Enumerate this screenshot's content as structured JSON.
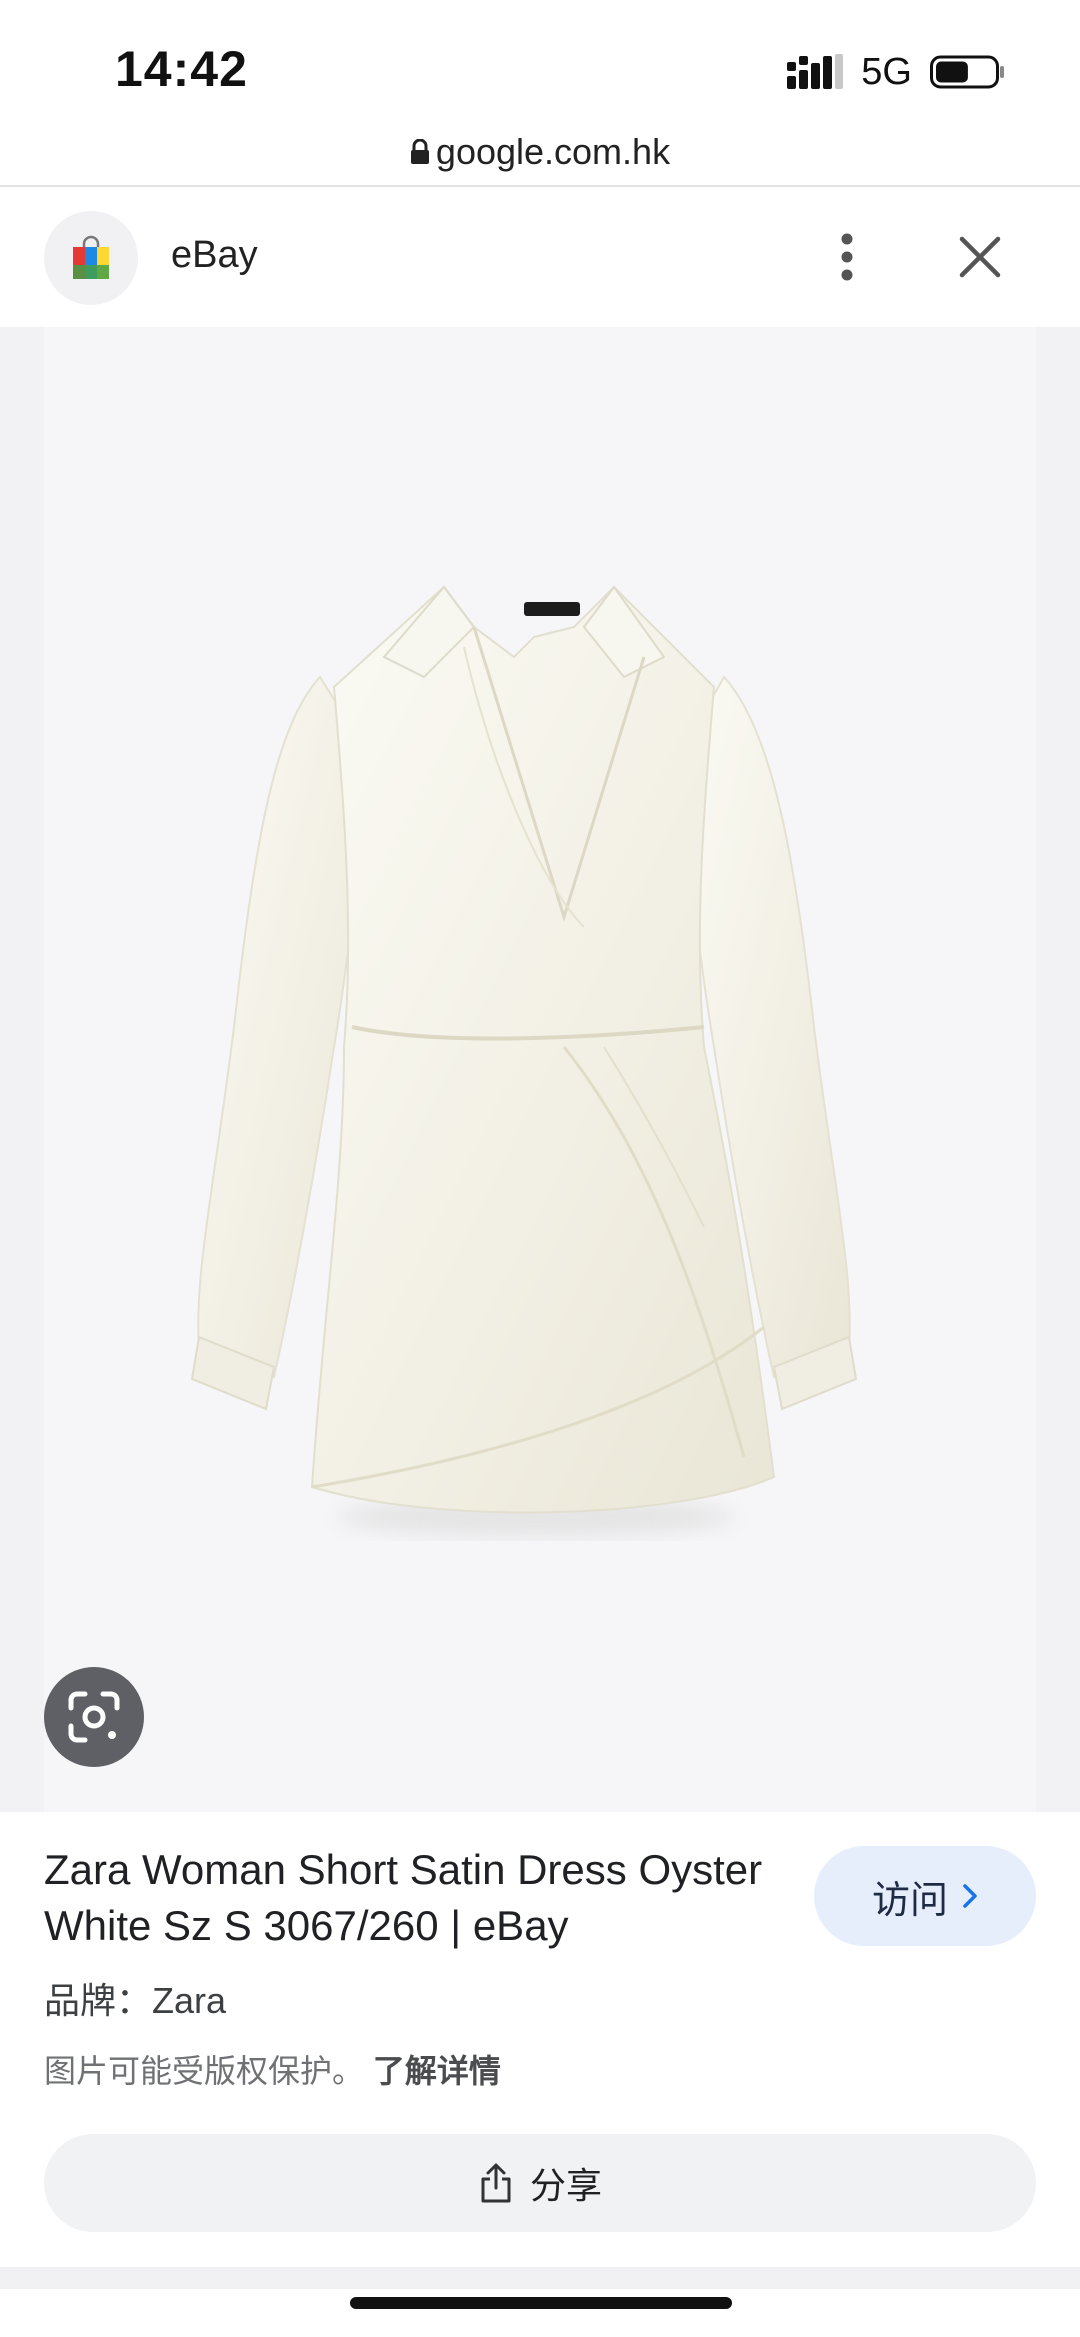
{
  "status_bar": {
    "time": "14:42",
    "network": "5G",
    "battery_level": 0.55
  },
  "browser": {
    "url": "google.com.hk"
  },
  "source": {
    "name": "eBay"
  },
  "product": {
    "title": "Zara Woman Short Satin Dress Oyster White Sz S 3067/260 | eBay",
    "brand_label": "品牌：",
    "brand_value": "Zara",
    "copyright_notice": "图片可能受版权保护。",
    "learn_more": "了解详情"
  },
  "actions": {
    "visit_label": "访问",
    "share_label": "分享"
  },
  "colors": {
    "viewer_background": "#f2f2f4",
    "visit_button_bg": "#e6eefb",
    "dress": "#f6f4ec"
  },
  "icons": {
    "signal": "signal-icon",
    "battery": "battery-icon",
    "lock": "lock-icon",
    "source_logo": "shopping-bag-icon",
    "more": "more-vert-icon",
    "close": "close-icon",
    "lens": "google-lens-icon",
    "visit_arrow": "chevron-right-icon",
    "share": "share-icon"
  }
}
